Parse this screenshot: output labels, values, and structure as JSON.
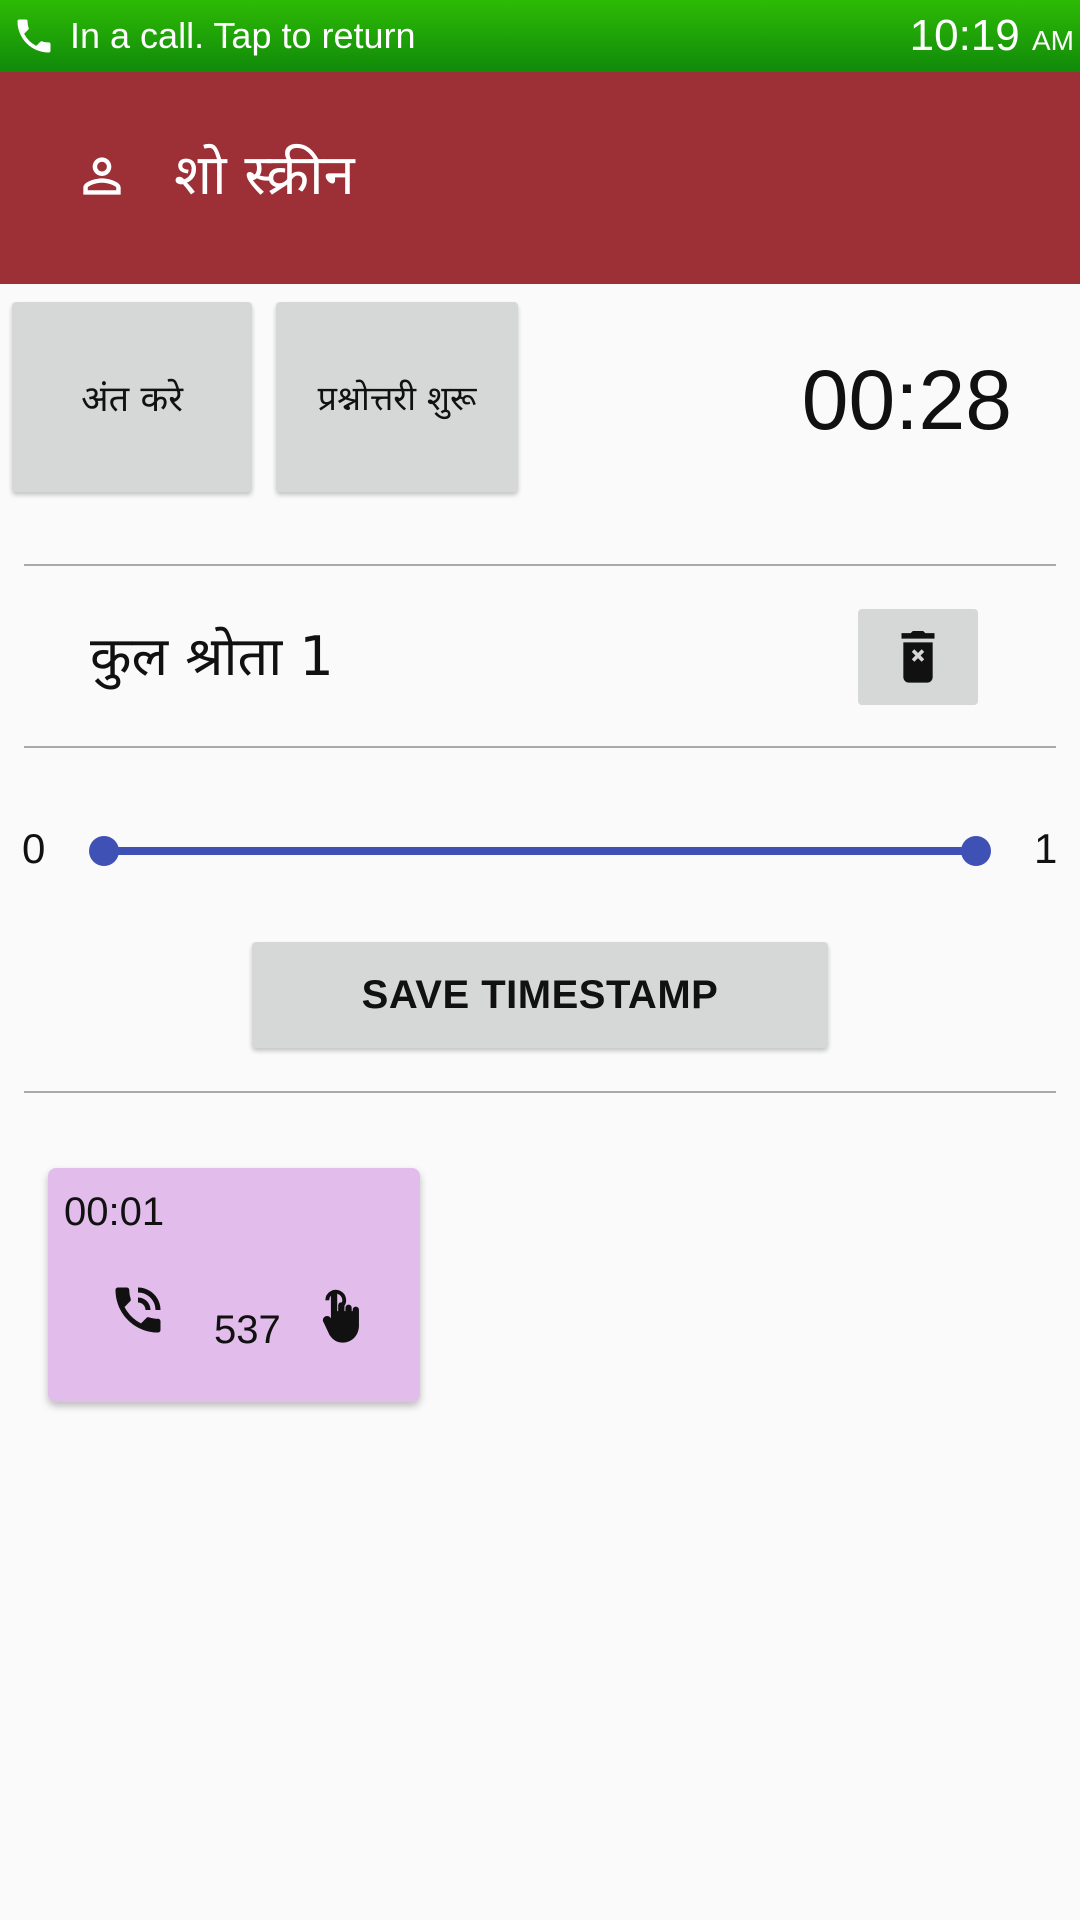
{
  "status_bar": {
    "call_text": "In a call. Tap to return",
    "time": "10:19",
    "ampm": "AM",
    "icon": "phone-icon",
    "color": "#1f9f08"
  },
  "app_bar": {
    "icon": "person-icon",
    "title": "शो स्क्रीन",
    "color": "#9c3036"
  },
  "controls": {
    "end_label": "अंत करे",
    "quiz_label": "प्रश्नोत्तरी शुरू",
    "timer": "00:28"
  },
  "listeners": {
    "label": "कुल श्रोता 1",
    "delete_icon": "delete-forever-icon"
  },
  "range": {
    "min_label": "0",
    "max_label": "1",
    "low": 0,
    "high": 1,
    "accent": "#3f51b5"
  },
  "save_button": {
    "label": "SAVE TIMESTAMP"
  },
  "timestamps": [
    {
      "time": "00:01",
      "number": "537",
      "call_icon": "phone-in-talk-icon",
      "hand_icon": "hand-pointer-icon",
      "color": "#e2bdec"
    }
  ]
}
